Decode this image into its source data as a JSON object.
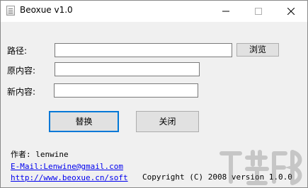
{
  "window": {
    "title": "Beoxue v1.0",
    "controls": [
      "minimize-icon",
      "maximize-icon",
      "close-icon"
    ]
  },
  "form": {
    "path_label": "路径:",
    "path_value": "",
    "browse_label": "浏览",
    "original_label": "原内容:",
    "original_value": "",
    "new_label": "新内容:",
    "new_value": ""
  },
  "actions": {
    "replace_label": "替换",
    "close_label": "关闭"
  },
  "footer": {
    "author": "作者: lenwine",
    "email": "E-Mail:Lenwine@gmail.com",
    "website": "http://www.beoxue.cn/soft",
    "copyright": "Copyright (C) 2008 version 1.0.0"
  },
  "colors": {
    "window_bg": "#f0f0f0",
    "titlebar_bg": "#ffffff",
    "focus_border": "#0078d7",
    "link": "#0000ee"
  }
}
